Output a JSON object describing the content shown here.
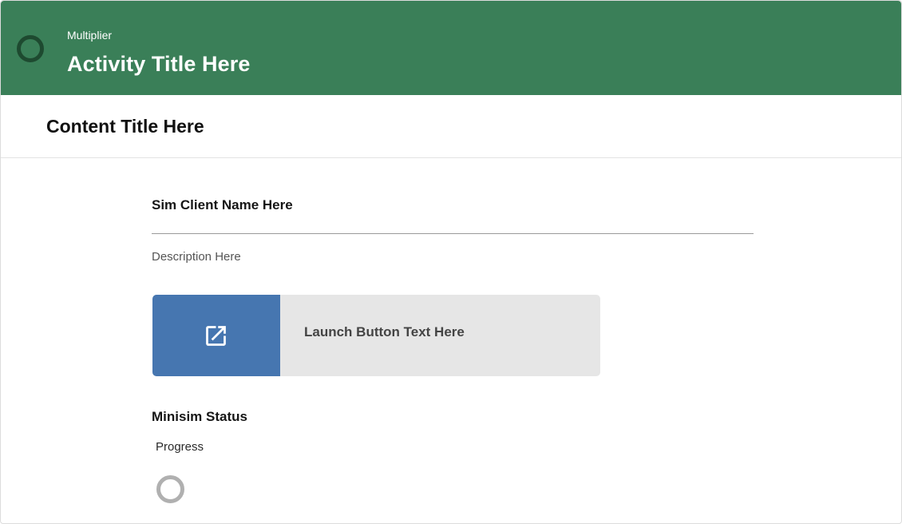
{
  "header": {
    "eyebrow": "Multiplier",
    "title": "Activity Title Here",
    "icon": "status-ring-icon",
    "background_color": "#3a7f58"
  },
  "content": {
    "title": "Content Title Here"
  },
  "sim": {
    "client_name": "Sim Client Name Here",
    "description": "Description Here",
    "launch_button": {
      "label": "Launch Button Text Here",
      "icon": "external-link-icon",
      "accent_color": "#4676b0"
    }
  },
  "status": {
    "heading": "Minisim Status",
    "progress_label": "Progress",
    "progress_icon": "progress-ring-icon"
  }
}
